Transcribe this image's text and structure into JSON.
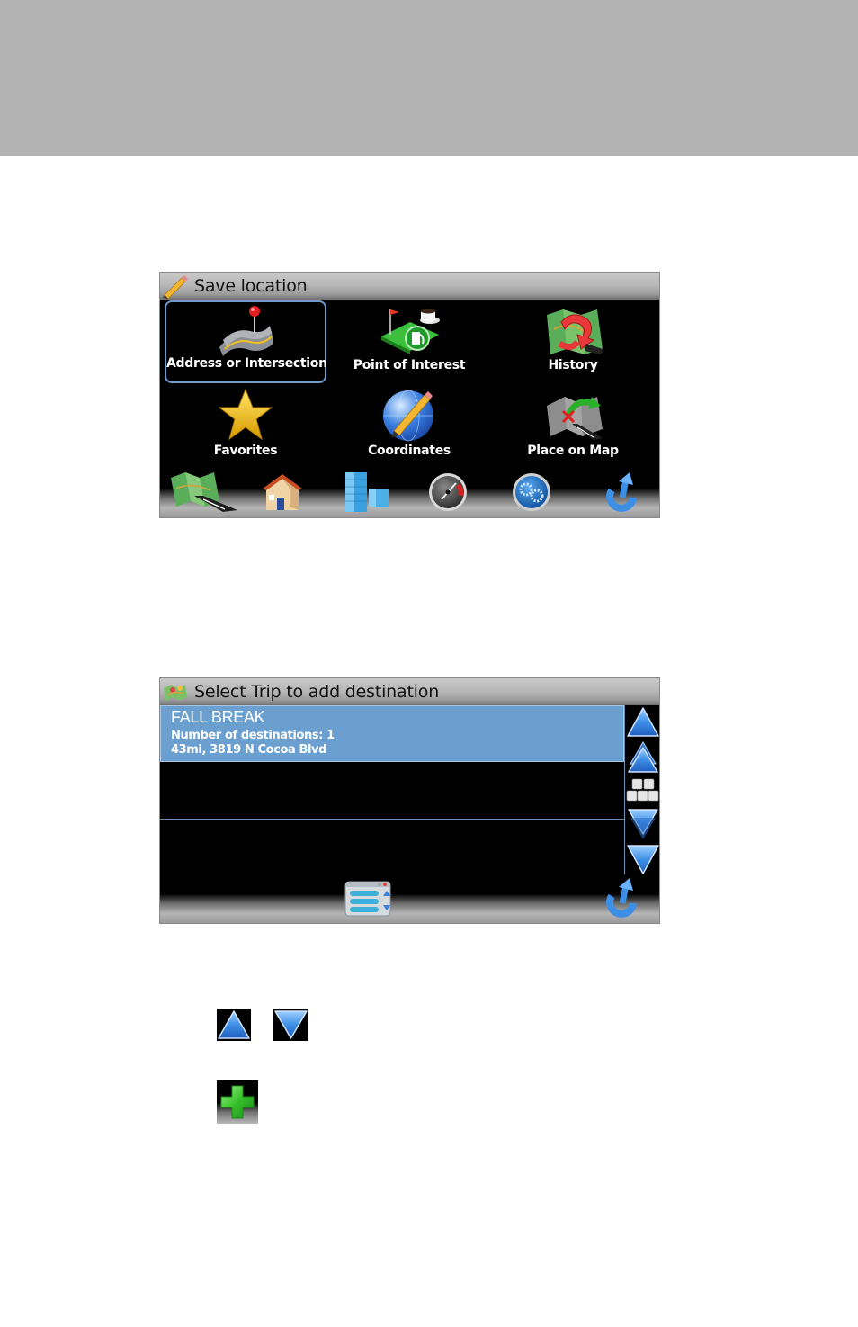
{
  "panel1": {
    "title": "Save location",
    "header_icon": "pencil-icon",
    "tiles": [
      {
        "label": "Address or Intersection",
        "icon": "address-road-pin-icon",
        "selected": true
      },
      {
        "label": "Point of Interest",
        "icon": "poi-fuel-coffee-icon",
        "selected": false
      },
      {
        "label": "History",
        "icon": "history-map-arrow-icon",
        "selected": false
      },
      {
        "label": "Favorites",
        "icon": "star-icon",
        "selected": false
      },
      {
        "label": "Coordinates",
        "icon": "globe-pencil-icon",
        "selected": false
      },
      {
        "label": "Place on Map",
        "icon": "place-on-map-icon",
        "selected": false
      }
    ],
    "bottom_bar": [
      {
        "icon": "map-icon",
        "name": "map-button"
      },
      {
        "icon": "home-icon",
        "name": "home-button"
      },
      {
        "icon": "buildings-icon",
        "name": "buildings-button"
      },
      {
        "icon": "speedometer-icon",
        "name": "speedometer-button"
      },
      {
        "icon": "settings-gears-icon",
        "name": "settings-button"
      },
      {
        "icon": "back-arrow-icon",
        "name": "back-button"
      }
    ]
  },
  "panel2": {
    "title": "Select Trip to add destination",
    "header_icon": "trip-map-icon",
    "items": [
      {
        "title": "FALL BREAK",
        "line1": "Number of destinations: 1",
        "line2": "43mi, 3819 N Cocoa Blvd",
        "selected": true
      },
      {
        "title": "",
        "line1": "",
        "line2": "",
        "selected": false
      },
      {
        "title": "",
        "line1": "",
        "line2": "",
        "selected": false
      }
    ],
    "scroll_buttons": [
      {
        "icon": "page-up-icon",
        "name": "page-up-button"
      },
      {
        "icon": "scroll-up-icon",
        "name": "scroll-up-button"
      },
      {
        "icon": "keyboard-icon",
        "name": "keyboard-button"
      },
      {
        "icon": "scroll-down-icon",
        "name": "scroll-down-button"
      },
      {
        "icon": "page-down-icon",
        "name": "page-down-button"
      }
    ],
    "bottom_bar": [
      {
        "icon": "list-window-icon",
        "name": "list-options-button"
      },
      {
        "icon": "back-arrow-icon",
        "name": "back-button"
      }
    ]
  },
  "legend": [
    {
      "icon": "up-arrow-icon"
    },
    {
      "icon": "down-arrow-icon"
    },
    {
      "icon": "green-plus-icon"
    }
  ],
  "colors": {
    "selection_blue": "#6a9fcf",
    "selection_border": "#6f9ccb",
    "panel_bg": "#000000",
    "banner_gray": "#b3b3b3"
  }
}
